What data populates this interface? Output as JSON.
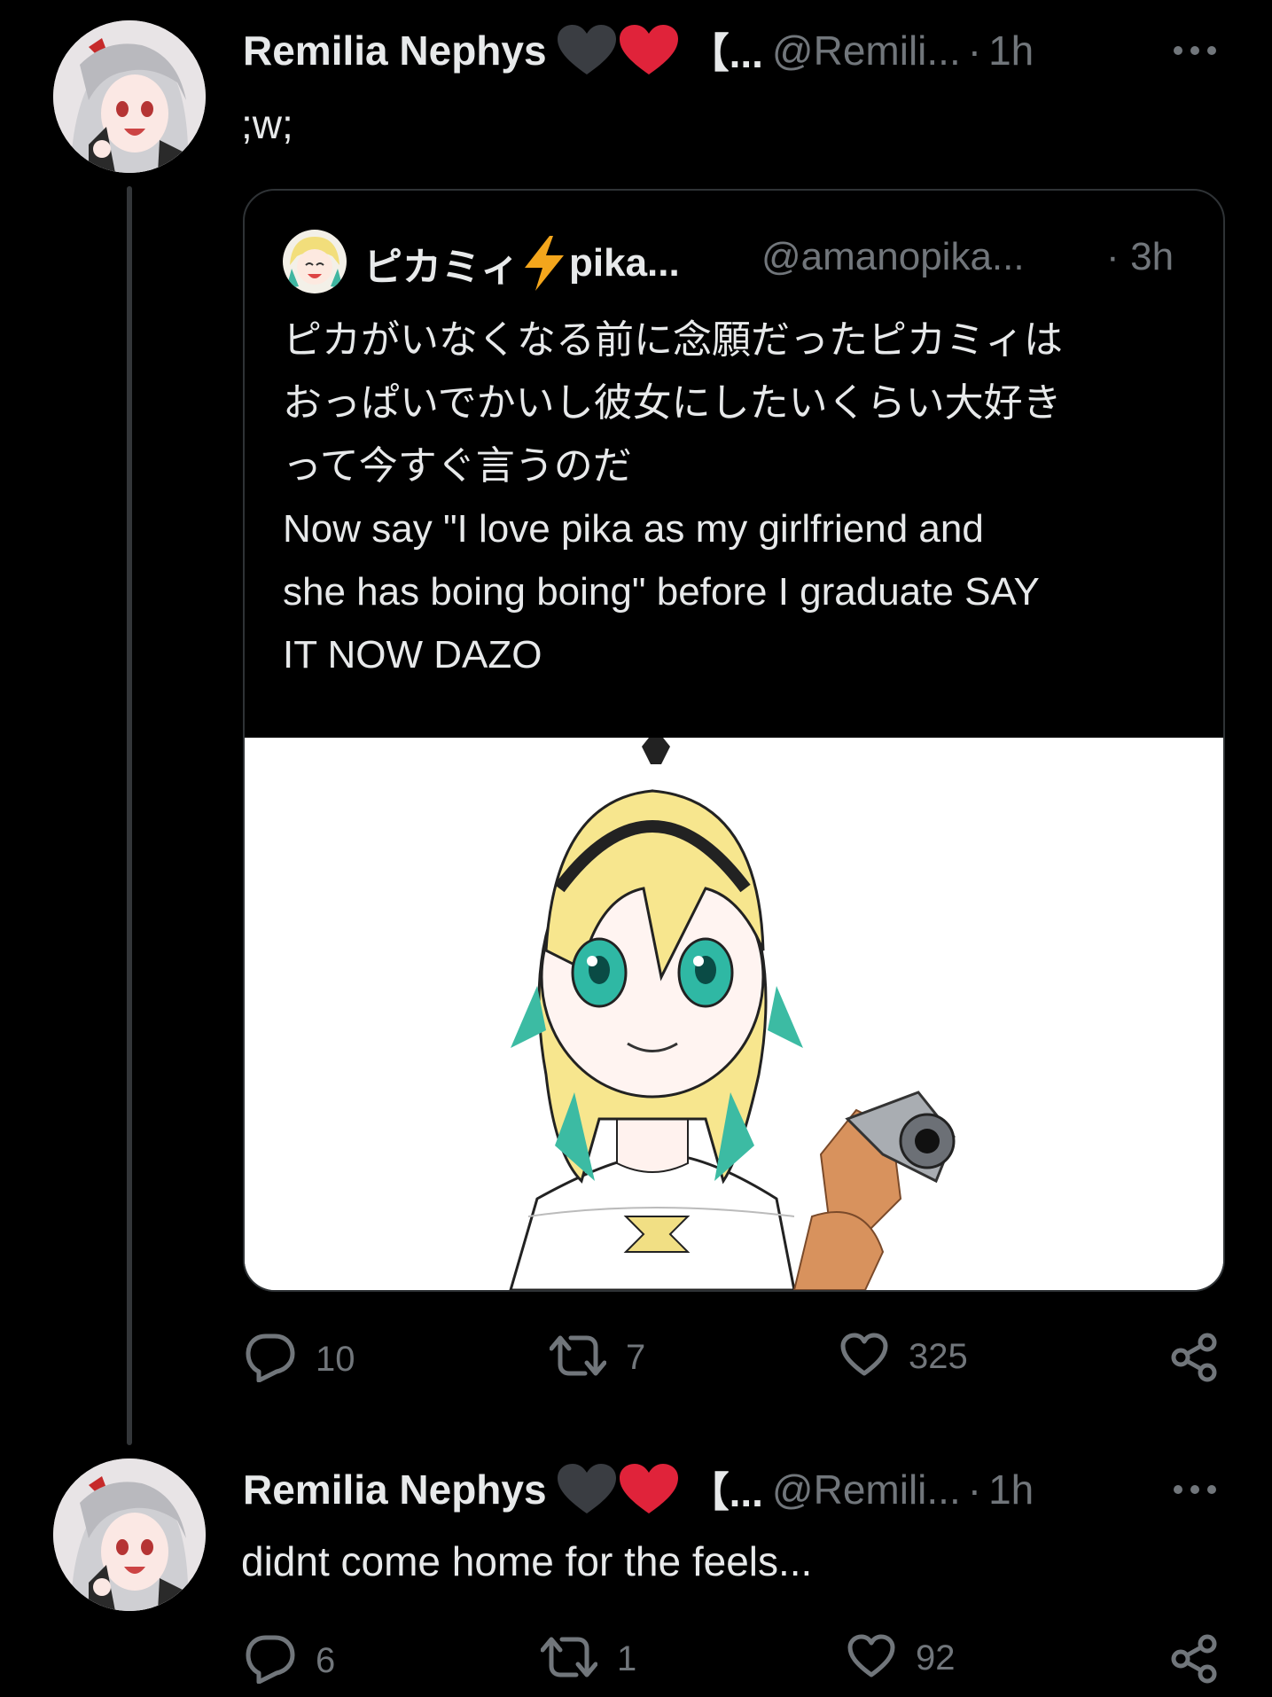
{
  "tweet1": {
    "author_name": "Remilia Nephys",
    "name_suffix": "【...",
    "handle": "@Remili...",
    "separator": "·",
    "time": "1h",
    "text": ";w;",
    "quoted": {
      "author_name": "ピカミィ",
      "name_suffix": "pika...",
      "handle": "@amanopika...",
      "separator": "·",
      "time": "3h",
      "text": "ピカがいなくなる前に念願だったピカミィは\nおっぱいでかいし彼女にしたいくらい大好き\nって今すぐ言うのだ\nNow say \"I love pika as my girlfriend and\nshe has boing boing\" before I graduate SAY\nIT NOW DAZO"
    },
    "actions": {
      "replies": "10",
      "retweets": "7",
      "likes": "325"
    }
  },
  "tweet2": {
    "author_name": "Remilia Nephys",
    "name_suffix": "【...",
    "handle": "@Remili...",
    "separator": "·",
    "time": "1h",
    "text": "didnt come home for the feels...",
    "actions": {
      "replies": "6",
      "retweets": "1",
      "likes": "92"
    }
  },
  "icons": {
    "reply": "reply-icon",
    "retweet": "retweet-icon",
    "like": "heart-outline-icon",
    "share": "share-icon",
    "more": "more-dots-icon",
    "emoji_black_heart": "black-heart-icon",
    "emoji_red_heart": "red-heart-icon",
    "emoji_lightning": "lightning-icon"
  },
  "colors": {
    "background": "#000000",
    "text": "#e7e9ea",
    "secondary": "#71767b",
    "border": "#2f3336",
    "thread_line": "#333639"
  }
}
